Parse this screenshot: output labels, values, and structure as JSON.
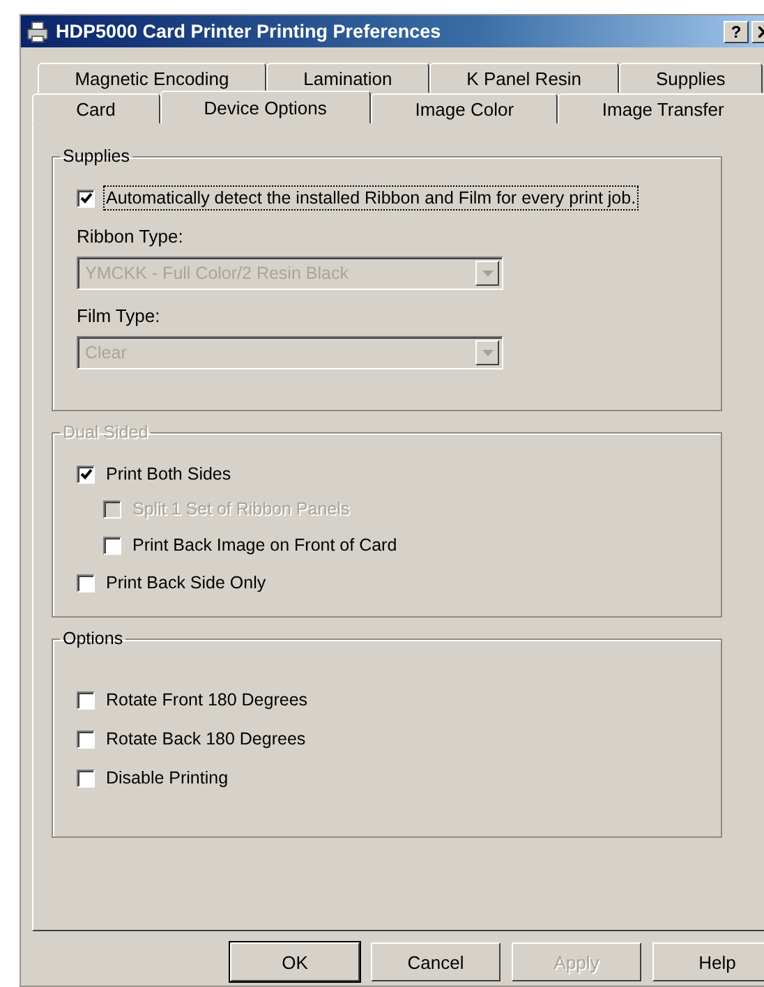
{
  "window": {
    "title": "HDP5000 Card Printer Printing Preferences",
    "help": "?"
  },
  "tab_rows": [
    {
      "tabs": [
        {
          "label": "Magnetic Encoding",
          "selected": false
        },
        {
          "label": "Lamination",
          "selected": false
        },
        {
          "label": "K Panel Resin",
          "selected": false
        },
        {
          "label": "Supplies",
          "selected": false
        }
      ]
    },
    {
      "tabs": [
        {
          "label": "Card",
          "selected": false
        },
        {
          "label": "Device Options",
          "selected": true
        },
        {
          "label": "Image Color",
          "selected": false
        },
        {
          "label": "Image Transfer",
          "selected": false
        }
      ]
    }
  ],
  "sections": [
    {
      "title": "Supplies",
      "disabled": false,
      "items": [
        {
          "kind": "checkbox",
          "label": "Automatically detect the installed Ribbon and Film for every print job.",
          "checked": true,
          "disabled": false,
          "focused": true
        },
        {
          "kind": "dropdown",
          "label": "Ribbon Type:",
          "value": "YMCKK - Full Color/2 Resin Black",
          "disabled": true
        },
        {
          "kind": "dropdown",
          "label": "Film Type:",
          "value": "Clear",
          "disabled": true
        }
      ]
    },
    {
      "title": "Dual Sided",
      "disabled": true,
      "items": [
        {
          "kind": "checkbox",
          "label": "Print Both Sides",
          "checked": true,
          "disabled": false,
          "focused": false,
          "children": [
            {
              "kind": "checkbox",
              "label": "Split 1 Set of Ribbon Panels",
              "checked": false,
              "disabled": true,
              "focused": false
            },
            {
              "kind": "checkbox",
              "label": "Print Back Image on Front of Card",
              "checked": false,
              "disabled": false,
              "focused": false
            }
          ]
        },
        {
          "kind": "checkbox",
          "label": "Print Back Side Only",
          "checked": false,
          "disabled": false,
          "focused": false
        }
      ]
    },
    {
      "title": "Options",
      "disabled": false,
      "items": [
        {
          "kind": "checkbox",
          "label": "Rotate Front 180 Degrees",
          "checked": false,
          "disabled": false,
          "focused": false
        },
        {
          "kind": "checkbox",
          "label": "Rotate Back 180 Degrees",
          "checked": false,
          "disabled": false,
          "focused": false
        },
        {
          "kind": "checkbox",
          "label": "Disable Printing",
          "checked": false,
          "disabled": false,
          "focused": false
        }
      ]
    }
  ],
  "buttons": [
    {
      "label": "OK",
      "default": true,
      "disabled": false
    },
    {
      "label": "Cancel",
      "default": false,
      "disabled": false
    },
    {
      "label": "Apply",
      "default": false,
      "disabled": true
    },
    {
      "label": "Help",
      "default": false,
      "disabled": false
    }
  ]
}
